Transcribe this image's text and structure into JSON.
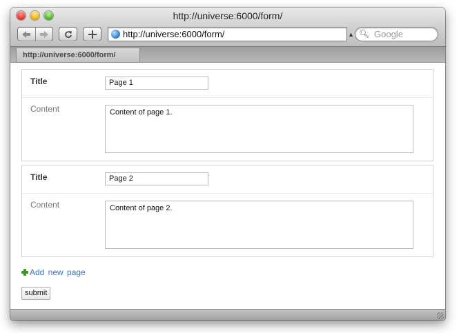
{
  "window": {
    "title": "http://universe:6000/form/"
  },
  "toolbar": {
    "back_icon": "left-arrow",
    "forward_icon": "right-arrow",
    "reload_icon": "reload-arrow",
    "add_icon": "plus",
    "address": "http://universe:6000/form/",
    "search_placeholder": "Google"
  },
  "tabs": [
    {
      "label": "http://universe:6000/form/"
    }
  ],
  "form": {
    "entries": [
      {
        "title_label": "Title",
        "title_value": "Page 1",
        "content_label": "Content",
        "content_value": "Content of page 1."
      },
      {
        "title_label": "Title",
        "title_value": "Page 2",
        "content_label": "Content",
        "content_value": "Content of page 2."
      }
    ],
    "add_link": "Add new page",
    "submit_label": "submit"
  },
  "colors": {
    "link": "#3f72b8",
    "plus_icon": "#3a9a25"
  }
}
